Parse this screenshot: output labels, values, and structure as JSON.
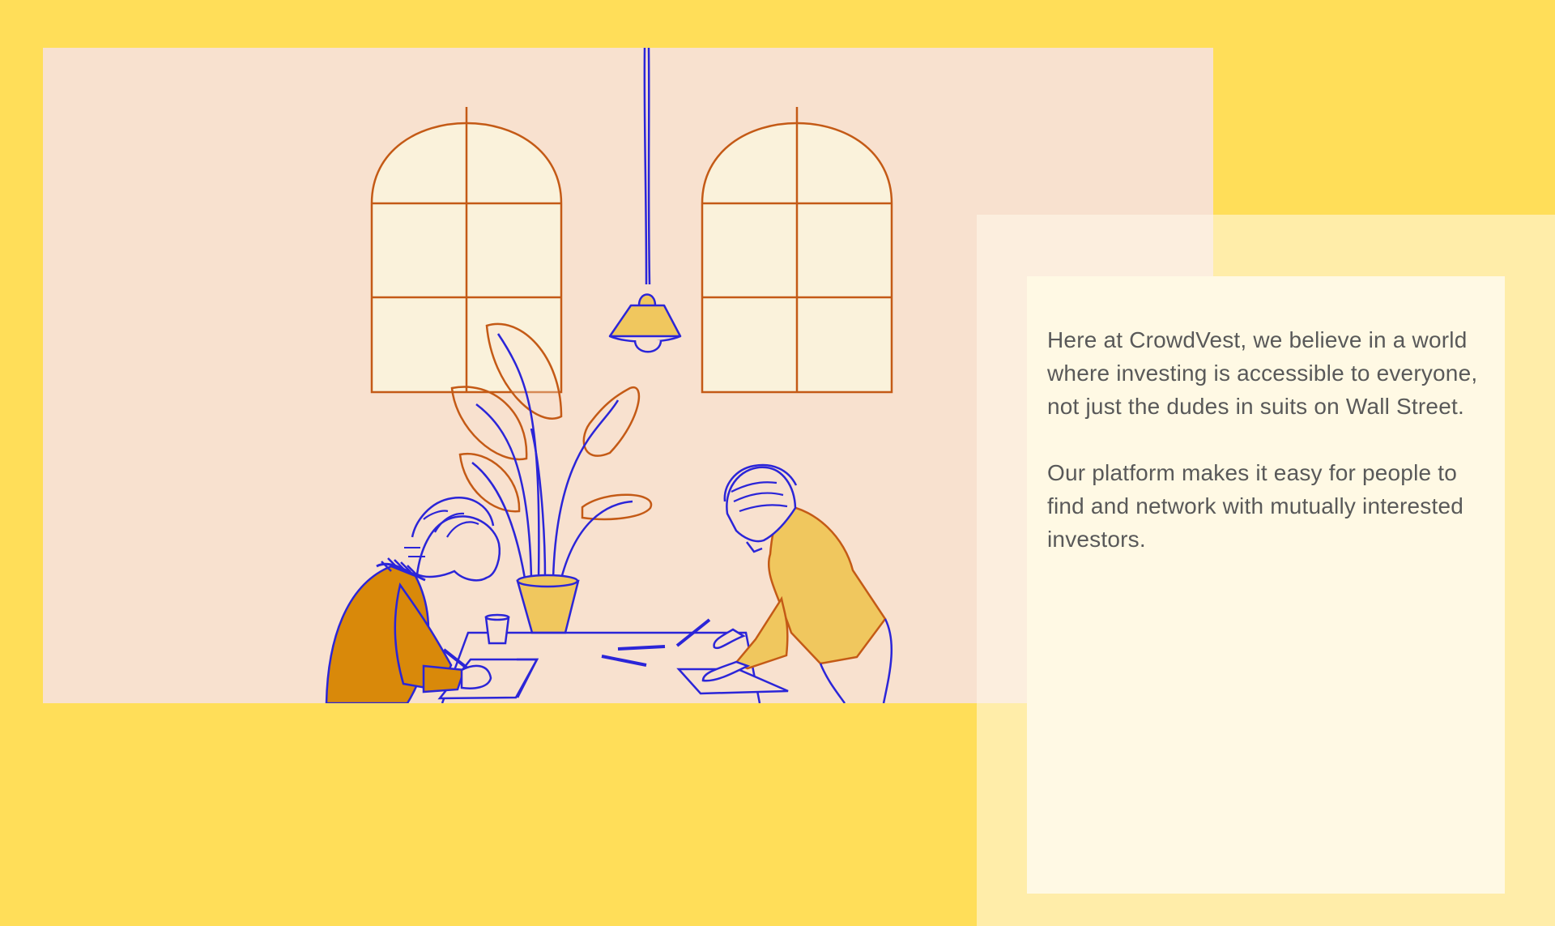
{
  "page": {
    "background_color": "#FFDE59"
  },
  "illustration": {
    "panel_color": "#F8E1CF",
    "line_blue": "#2B25D8",
    "line_orange": "#C45A16",
    "fill_mustard": "#F0C75E",
    "fill_orange": "#D9890A",
    "window_fill": "#FAF2DB",
    "subject": "two people working at a table beside a potted plant under a hanging lamp with two arched windows"
  },
  "card": {
    "outer_color": "#FFF4C7",
    "inner_color": "#FFF9E4",
    "paragraph_1": "Here at CrowdVest, we believe in a world where investing is accessible to everyone, not just the dudes in suits on Wall Street.",
    "paragraph_2": "Our platform makes it easy for people to find and network with mutually interested investors."
  }
}
